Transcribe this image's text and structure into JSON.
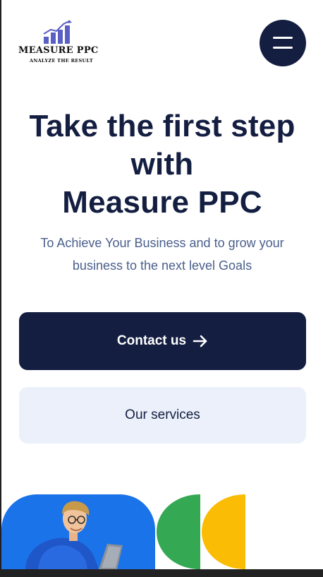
{
  "header": {
    "logo_name": "MEASURE PPC",
    "logo_tagline": "ANALYZE THE RESULT",
    "menu_icon": "hamburger-menu-icon"
  },
  "hero": {
    "title_line1": "Take the first step",
    "title_line2": "with",
    "title_line3": "Measure PPC",
    "subtitle_line1": "To Achieve Your Business and to grow your",
    "subtitle_line2": "business to the next level Goals"
  },
  "buttons": {
    "contact_label": "Contact us",
    "contact_icon": "arrow-right-icon",
    "services_label": "Our services"
  },
  "colors": {
    "navy": "#141e41",
    "subtitle": "#4a5f8c",
    "services_bg": "#ebf0fb",
    "blue_shape": "#1a73e8",
    "green_shape": "#34a853",
    "yellow_shape": "#fbbc05",
    "logo_purple": "#5a5fc4"
  }
}
